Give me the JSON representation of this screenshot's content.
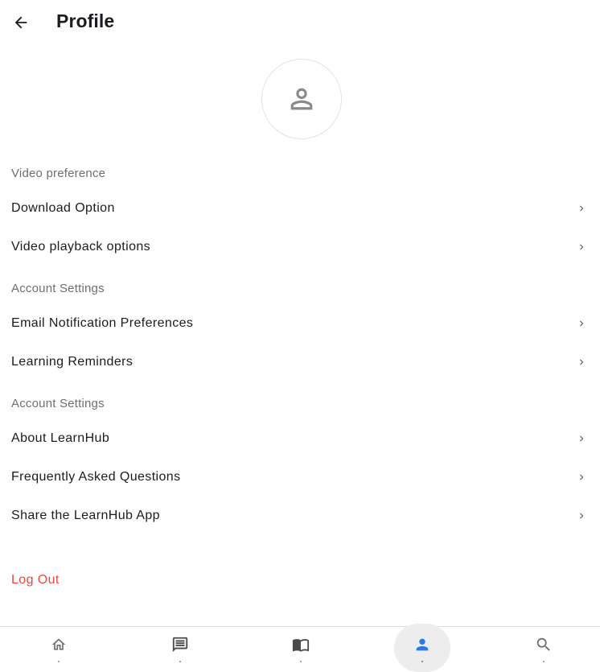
{
  "header": {
    "title": "Profile",
    "back_icon": "arrow-back-icon"
  },
  "avatar": {
    "icon": "person-outline-icon"
  },
  "sections": [
    {
      "title": "Video preference",
      "items": [
        {
          "label": "Download Option",
          "icon": "chevron-right-icon"
        },
        {
          "label": "Video playback options",
          "icon": "chevron-right-icon"
        }
      ]
    },
    {
      "title": "Account Settings",
      "items": [
        {
          "label": "Email Notification Preferences",
          "icon": "chevron-right-icon"
        },
        {
          "label": "Learning Reminders",
          "icon": "chevron-right-icon"
        }
      ]
    },
    {
      "title": "Account Settings",
      "items": [
        {
          "label": "About LearnHub",
          "icon": "chevron-right-icon"
        },
        {
          "label": "Frequently Asked Questions",
          "icon": "chevron-right-icon"
        },
        {
          "label": "Share the LearnHub App",
          "icon": "chevron-right-icon"
        }
      ]
    }
  ],
  "logout": {
    "label": "Log Out",
    "color": "#e5483d"
  },
  "bottom_nav": {
    "items": [
      {
        "icon": "home-icon",
        "active": false
      },
      {
        "icon": "chat-icon",
        "active": false
      },
      {
        "icon": "book-icon",
        "active": false
      },
      {
        "icon": "person-icon",
        "active": true
      },
      {
        "icon": "search-icon",
        "active": false
      }
    ],
    "active_color": "#2c7be5"
  }
}
